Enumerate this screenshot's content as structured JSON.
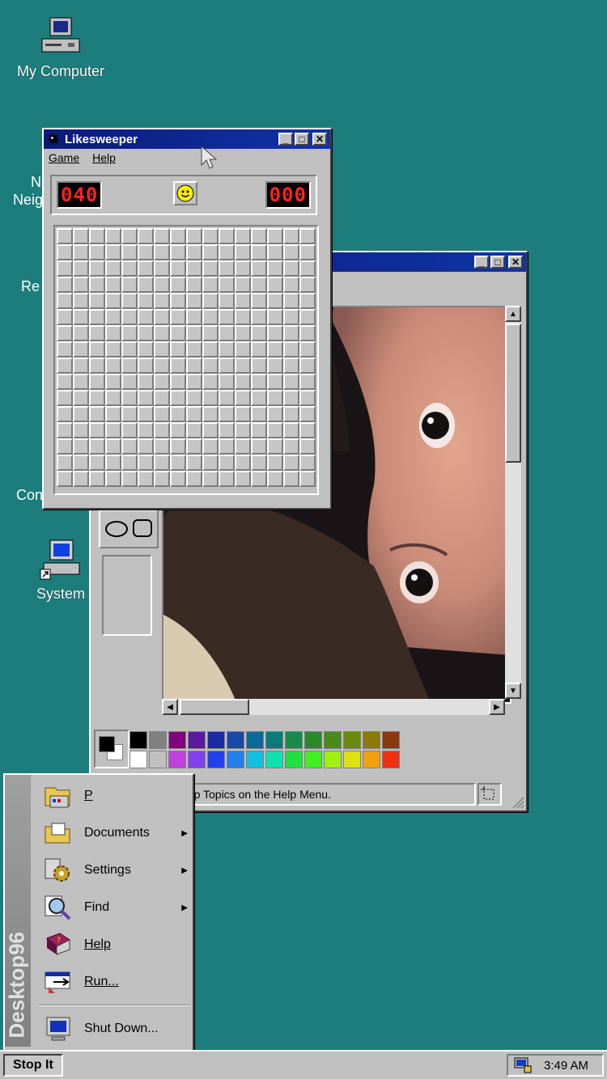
{
  "desktop": {
    "bg_color": "#1c7d7c",
    "icons": [
      {
        "label": "My Computer",
        "icon": "computer-icon"
      },
      {
        "label": "System",
        "icon": "system-computer-icon"
      }
    ],
    "partial_labels": [
      "N",
      "Neig",
      "Re",
      "Con"
    ]
  },
  "minesweeper": {
    "title": "Likesweeper",
    "menu": [
      "Game",
      "Help"
    ],
    "mines_counter": "040",
    "timer": "000",
    "face": "smiley-face-icon",
    "rows": 16,
    "cols": 16
  },
  "paint": {
    "status_text": "For Help, click Help Topics on the Help Menu.",
    "palette_row1": [
      "#000000",
      "#808080",
      "#800080",
      "#5a1aa0",
      "#1a2aa0",
      "#1a4aa8",
      "#0a6a9a",
      "#0a7a7a",
      "#1a8a4a",
      "#2a8a2a",
      "#4a8a1a",
      "#6a8a0a",
      "#8a7a0a",
      "#8a3a0a"
    ],
    "palette_row2": [
      "#ffffff",
      "#c0c0c0",
      "#c040e0",
      "#8040f0",
      "#2040f0",
      "#2080f0",
      "#10c0e0",
      "#10e0b0",
      "#20e040",
      "#40f020",
      "#a0f010",
      "#e0e010",
      "#f0a010",
      "#f03010"
    ],
    "fg_color": "#000000",
    "bg_color_swatch": "#ffffff"
  },
  "start_menu": {
    "banner": "Desktop96",
    "items": [
      {
        "label": "P",
        "icon": "programs-folder-icon",
        "submenu": false
      },
      {
        "label": "Documents",
        "icon": "documents-folder-icon",
        "submenu": true
      },
      {
        "label": "Settings",
        "icon": "settings-gear-icon",
        "submenu": true
      },
      {
        "label": "Find",
        "icon": "find-magnifier-icon",
        "submenu": true
      },
      {
        "label": "Help",
        "icon": "help-book-icon",
        "submenu": false
      },
      {
        "label": "Run...",
        "icon": "run-icon",
        "submenu": false
      },
      {
        "label": "Shut Down...",
        "icon": "shutdown-computer-icon",
        "submenu": false
      }
    ]
  },
  "taskbar": {
    "start_label": "Stop It",
    "clock": "3:49 AM",
    "tray_icon": "speaker-monitor-icon"
  }
}
